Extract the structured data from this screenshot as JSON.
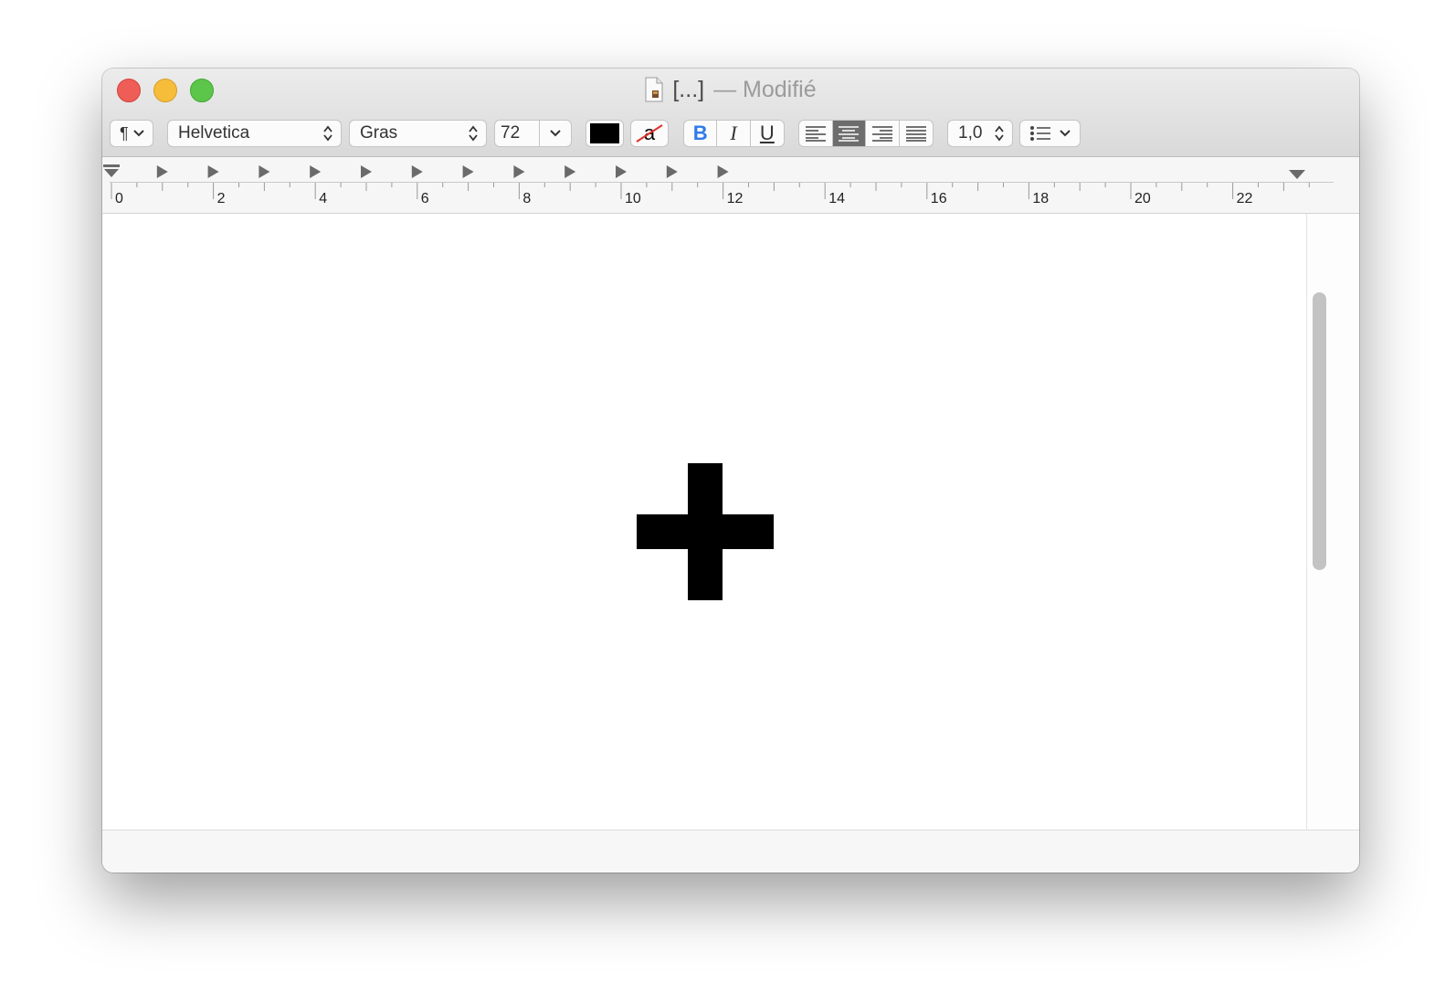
{
  "window": {
    "title": "[...]",
    "title_status": "— Modifié"
  },
  "toolbar": {
    "paragraph_styles_label": "¶",
    "font_family": "Helvetica",
    "font_style": "Gras",
    "font_size": "72",
    "text_color": "#000000",
    "highlight_label": "a",
    "bold_label": "B",
    "italic_label": "I",
    "underline_label": "U",
    "alignment_selected": "center",
    "line_spacing": "1,0"
  },
  "ruler": {
    "labels": [
      "0",
      "2",
      "4",
      "6",
      "8",
      "10",
      "12",
      "14",
      "16",
      "18",
      "20",
      "22"
    ]
  },
  "document": {
    "text": "+",
    "font_weight": "bold",
    "font_size": "72"
  },
  "colors": {
    "bold_blue": "#2f7bea",
    "strike_red": "#e0312a",
    "active_segment": "#6d6d6d"
  }
}
